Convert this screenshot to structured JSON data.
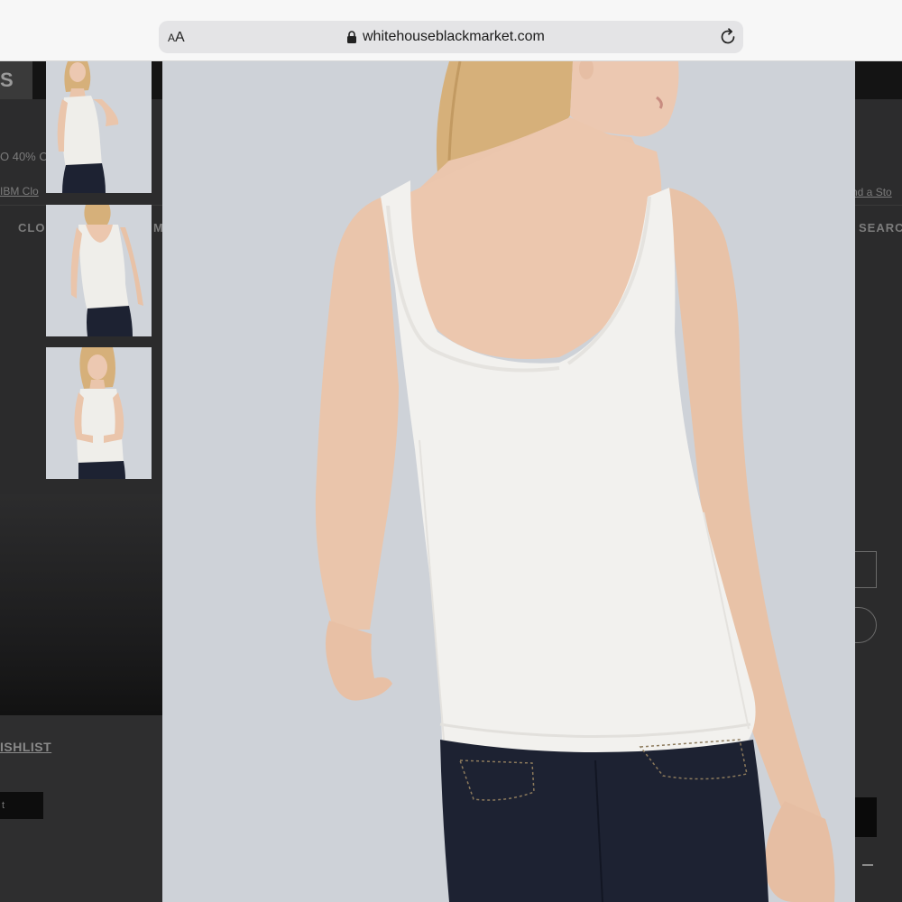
{
  "browser": {
    "reader_label_small": "A",
    "reader_label_large": "A",
    "url": "whitehouseblackmarket.com",
    "lock_icon": "lock-icon",
    "reload_icon": "reload-icon"
  },
  "site": {
    "logo_fragment": "S",
    "promo_fragment": "O 40% O",
    "ibm_link_fragment": "IBM Clo",
    "find_store_fragment": "nd a Sto",
    "nav_clothing_fragment": "CLO",
    "nav_m_fragment": "M",
    "nav_search_fragment": "SEARC",
    "wishlist_fragment": "ISHLIST",
    "button_fragment": "t"
  },
  "viewer": {
    "colors": {
      "background": "#ced2d8",
      "tank_top": "#f2f1ef",
      "jeans": "#1c2130",
      "skin": "#eccab4",
      "hair": "#d9b57e"
    }
  },
  "thumbnails": [
    {
      "view": "front",
      "selected": false
    },
    {
      "view": "back",
      "selected": true
    },
    {
      "view": "front-hands-together",
      "selected": false
    }
  ]
}
